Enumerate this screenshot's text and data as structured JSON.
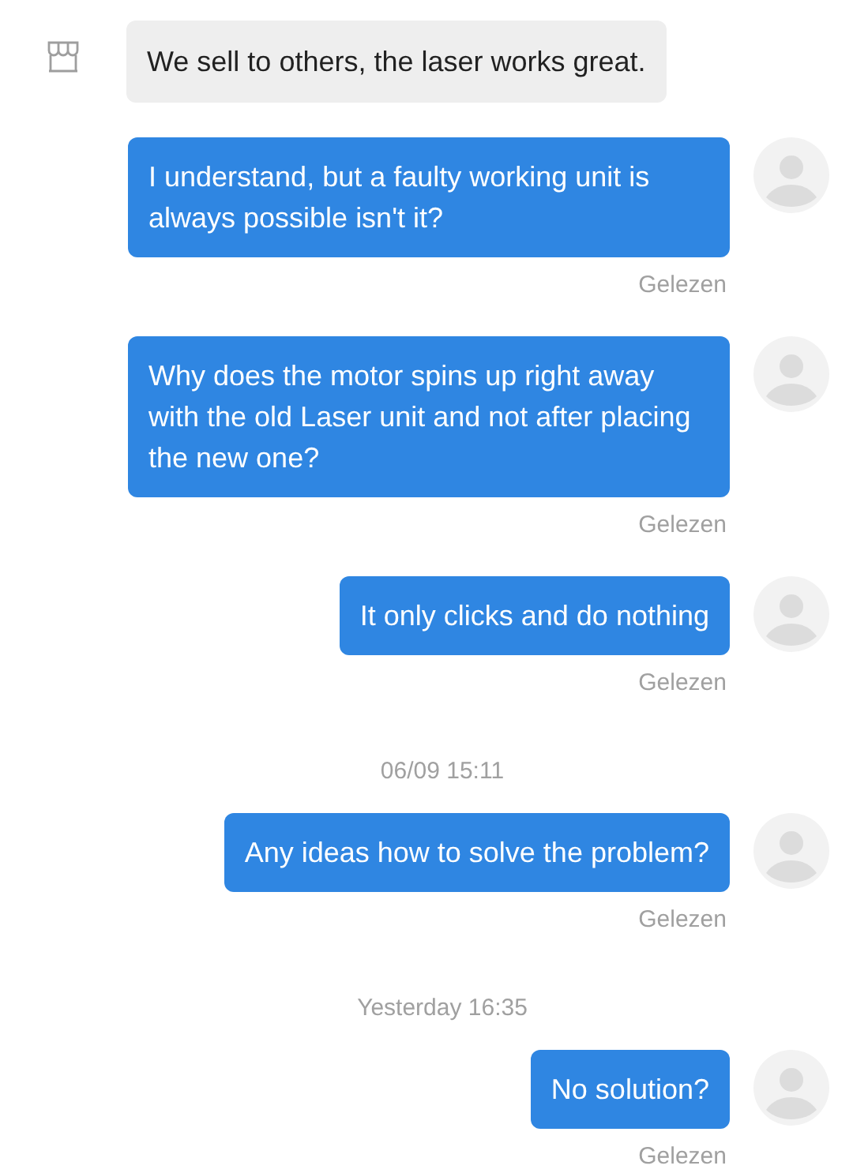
{
  "messages": [
    {
      "kind": "incoming",
      "text": "We sell to others, the laser works great."
    },
    {
      "kind": "outgoing",
      "text": "I understand, but a faulty working unit is always possible isn't it?",
      "status": "Gelezen"
    },
    {
      "kind": "outgoing",
      "text": "Why does the motor spins up right away with the old Laser unit and not after placing the new one?",
      "status": "Gelezen"
    },
    {
      "kind": "outgoing",
      "text": "It only clicks and do nothing",
      "status": "Gelezen"
    },
    {
      "kind": "timestamp",
      "text": "06/09 15:11"
    },
    {
      "kind": "outgoing",
      "text": "Any ideas how to solve the problem?",
      "status": "Gelezen"
    },
    {
      "kind": "timestamp",
      "text": "Yesterday 16:35"
    },
    {
      "kind": "outgoing",
      "text": "No solution?",
      "status": "Gelezen"
    }
  ]
}
